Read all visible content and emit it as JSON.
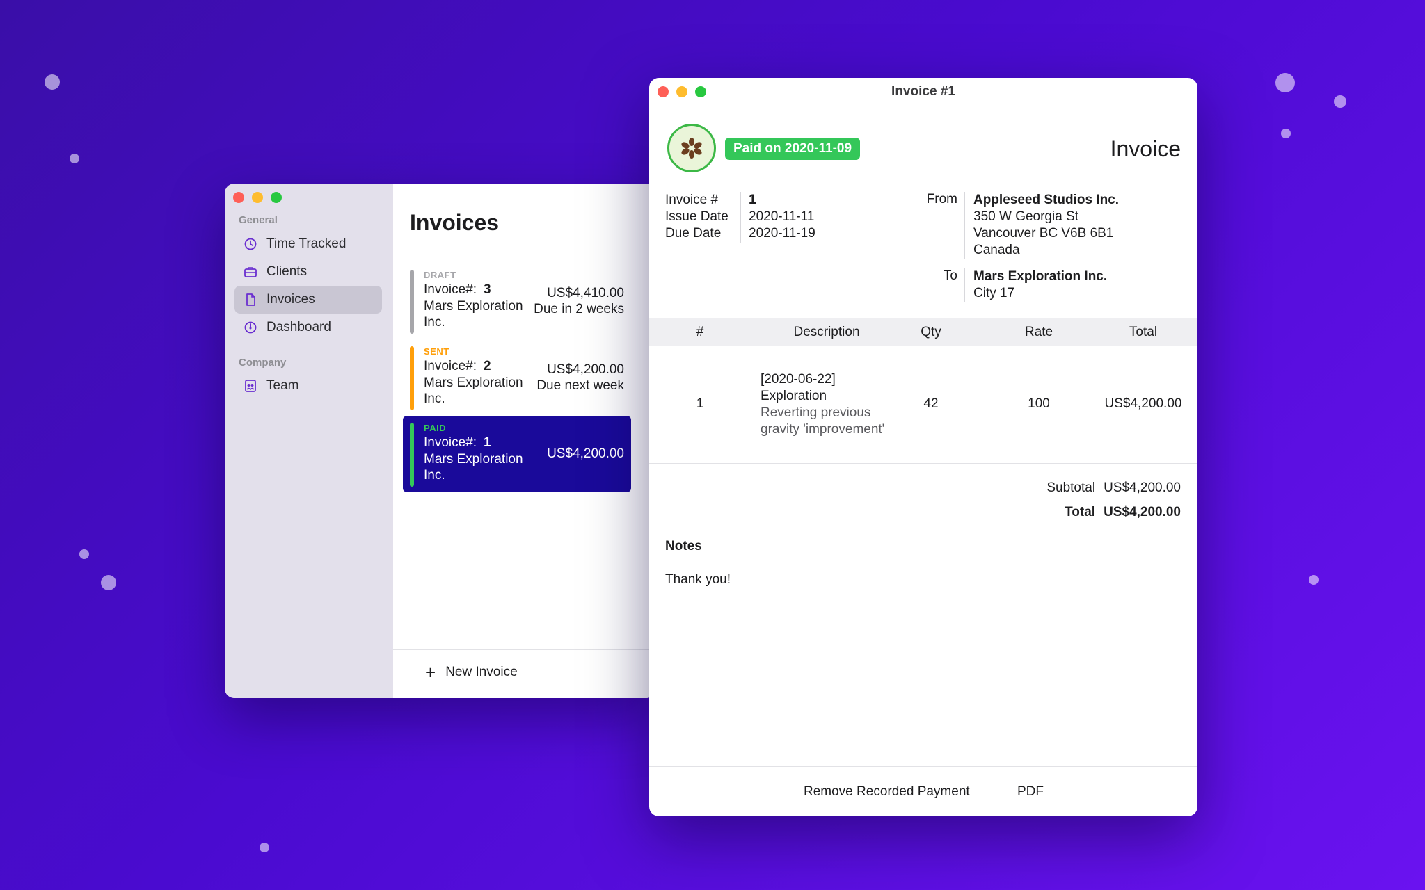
{
  "main_window": {
    "sidebar": {
      "section_general": "General",
      "section_company": "Company",
      "items": [
        {
          "label": "Time Tracked",
          "icon": "timer-icon"
        },
        {
          "label": "Clients",
          "icon": "briefcase-icon"
        },
        {
          "label": "Invoices",
          "icon": "document-icon",
          "active": true
        },
        {
          "label": "Dashboard",
          "icon": "gauge-icon"
        }
      ],
      "company_items": [
        {
          "label": "Team",
          "icon": "team-icon"
        }
      ]
    },
    "list": {
      "title": "Invoices",
      "invoices": [
        {
          "status": "DRAFT",
          "status_color": "#a6a6aa",
          "prefix": "Invoice#:",
          "number": "3",
          "client": "Mars Exploration Inc.",
          "amount": "US$4,410.00",
          "due": "Due in 2 weeks"
        },
        {
          "status": "SENT",
          "status_color": "#ff9f0a",
          "prefix": "Invoice#:",
          "number": "2",
          "client": "Mars Exploration Inc.",
          "amount": "US$4,200.00",
          "due": "Due next week"
        },
        {
          "status": "PAID",
          "status_color": "#34c759",
          "prefix": "Invoice#:",
          "number": "1",
          "client": "Mars Exploration Inc.",
          "amount": "US$4,200.00",
          "due": "",
          "selected": true
        }
      ],
      "new_invoice_label": "New Invoice"
    }
  },
  "invoice_window": {
    "title": "Invoice #1",
    "paid_badge": "Paid on 2020-11-09",
    "heading": "Invoice",
    "meta": {
      "invoice_no_label": "Invoice #",
      "issue_date_label": "Issue Date",
      "due_date_label": "Due Date",
      "invoice_no": "1",
      "issue_date": "2020-11-11",
      "due_date": "2020-11-19"
    },
    "from": {
      "label": "From",
      "name": "Appleseed Studios Inc.",
      "line1": "350 W Georgia St",
      "line2": "Vancouver BC V6B 6B1",
      "line3": "Canada"
    },
    "to": {
      "label": "To",
      "name": "Mars Exploration Inc.",
      "line1": "City 17"
    },
    "table": {
      "headers": {
        "num": "#",
        "description": "Description",
        "qty": "Qty",
        "rate": "Rate",
        "total": "Total"
      },
      "rows": [
        {
          "num": "1",
          "desc_title": "[2020-06-22] Exploration",
          "desc_detail": "Reverting previous gravity 'improvement'",
          "qty": "42",
          "rate": "100",
          "total": "US$4,200.00"
        }
      ]
    },
    "subtotal_label": "Subtotal",
    "subtotal": "US$4,200.00",
    "total_label": "Total",
    "total": "US$4,200.00",
    "notes_label": "Notes",
    "notes": "Thank you!",
    "footer": {
      "remove_payment": "Remove Recorded Payment",
      "pdf": "PDF"
    }
  }
}
